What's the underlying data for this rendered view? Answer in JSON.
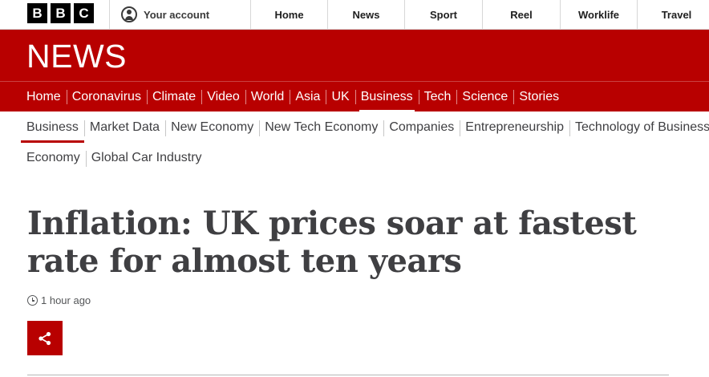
{
  "topbar": {
    "logo_letters": [
      "B",
      "B",
      "C"
    ],
    "account_label": "Your account",
    "account_icon": "account-icon",
    "nav": [
      "Home",
      "News",
      "Sport",
      "Reel",
      "Worklife",
      "Travel"
    ]
  },
  "banner": {
    "title": "NEWS",
    "background": "#b80000"
  },
  "primary_nav": {
    "items": [
      "Home",
      "Coronavirus",
      "Climate",
      "Video",
      "World",
      "Asia",
      "UK",
      "Business",
      "Tech",
      "Science",
      "Stories"
    ],
    "active": "Business"
  },
  "secondary_nav": {
    "row1": [
      "Business",
      "Market Data",
      "New Economy",
      "New Tech Economy",
      "Companies",
      "Entrepreneurship",
      "Technology of Business"
    ],
    "row2": [
      "Economy",
      "Global Car Industry"
    ],
    "active": "Business"
  },
  "article": {
    "headline": "Inflation: UK prices soar at fastest rate for almost ten years",
    "timestamp": "1 hour ago",
    "timestamp_icon": "clock-icon",
    "share_icon": "share-icon"
  }
}
